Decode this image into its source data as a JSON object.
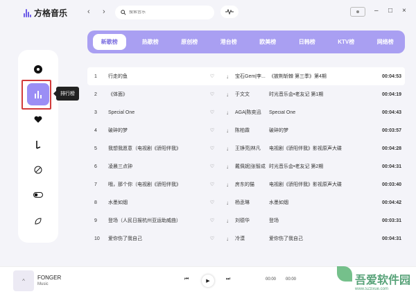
{
  "app": {
    "title": "方格音乐"
  },
  "header": {
    "search_placeholder": "搜索音乐",
    "back_icon": "‹",
    "forward_icon": "›",
    "minimize_icon": "–",
    "maximize_icon": "□",
    "close_icon": "×"
  },
  "sidebar": {
    "tooltip": "排行榜",
    "items": [
      {
        "icon": "disc-icon"
      },
      {
        "icon": "chart-icon"
      },
      {
        "icon": "heart-icon"
      },
      {
        "icon": "music-note-icon"
      },
      {
        "icon": "podcast-icon"
      },
      {
        "icon": "toggle-icon"
      },
      {
        "icon": "leaf-icon"
      }
    ]
  },
  "tabs": [
    "新歌榜",
    "热歌榜",
    "原创榜",
    "港台榜",
    "欧美榜",
    "日韩榜",
    "KTV榜",
    "网络榜"
  ],
  "songs": [
    {
      "num": "1",
      "title": "行走的鱼",
      "artist": "宝石Gem|李...",
      "album": "《披荆斩棘 第三季》第4期",
      "time": "00:04:53"
    },
    {
      "num": "2",
      "title": "《体面》",
      "artist": "于文文",
      "album": "时光音乐会•老友记 第1期",
      "time": "00:04:19"
    },
    {
      "num": "3",
      "title": "Special One",
      "artist": "AGA|陈奕迅",
      "album": "Special One",
      "time": "00:04:43"
    },
    {
      "num": "4",
      "title": "破碎的梦",
      "artist": "陈柏霖",
      "album": "破碎的梦",
      "time": "00:03:57"
    },
    {
      "num": "5",
      "title": "我想我愿意（电视剧《骄阳伴我》",
      "artist": "王铮亮|林凡",
      "album": "电视剧《骄阳伴我》影视原声大碟",
      "time": "00:04:28"
    },
    {
      "num": "6",
      "title": "凌晨三点钟",
      "artist": "戴佩妮|张智成",
      "album": "时光音乐会•老友记 第2期",
      "time": "00:04:31"
    },
    {
      "num": "7",
      "title": "哦，那个你（电视剧《骄阳伴我》",
      "artist": "房东的猫",
      "album": "电视剧《骄阳伴我》影视原声大碟",
      "time": "00:03:40"
    },
    {
      "num": "8",
      "title": "水墨如烟",
      "artist": "杨丞琳",
      "album": "水墨如烟",
      "time": "00:04:42"
    },
    {
      "num": "9",
      "title": "登场（人民日报杭州亚运助威曲）",
      "artist": "刘德华",
      "album": "登场",
      "time": "00:03:31"
    },
    {
      "num": "10",
      "title": "爱你伤了我自己",
      "artist": "冷漠",
      "album": "爱你伤了我自己",
      "time": "00:04:31"
    }
  ],
  "player": {
    "song_name": "FONGER",
    "song_sub": "Music",
    "current_time": "00:00",
    "total_time": "00:00",
    "prev_icon": "⏮",
    "play_icon": "▶",
    "next_icon": "⏭",
    "cover_glyph": "^"
  },
  "watermark": {
    "text": "吾爱软件园",
    "url": "www.52zixue.com"
  },
  "colors": {
    "accent": "#9b8ef5",
    "tab_bar": "#a99ff2",
    "highlight": "#d23b3b"
  }
}
